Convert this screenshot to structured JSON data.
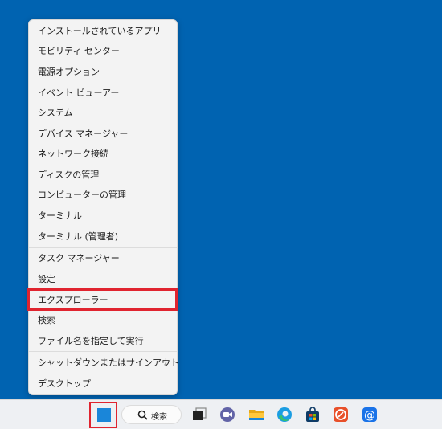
{
  "menu": {
    "items": [
      {
        "label": "インストールされているアプリ"
      },
      {
        "label": "モビリティ センター"
      },
      {
        "label": "電源オプション"
      },
      {
        "label": "イベント ビューアー"
      },
      {
        "label": "システム"
      },
      {
        "label": "デバイス マネージャー"
      },
      {
        "label": "ネットワーク接続"
      },
      {
        "label": "ディスクの管理"
      },
      {
        "label": "コンピューターの管理"
      },
      {
        "label": "ターミナル"
      },
      {
        "label": "ターミナル (管理者)"
      },
      {
        "label": "タスク マネージャー"
      },
      {
        "label": "設定"
      },
      {
        "label": "エクスプローラー"
      },
      {
        "label": "検索"
      },
      {
        "label": "ファイル名を指定して実行"
      },
      {
        "label": "シャットダウンまたはサインアウト",
        "chevron": "›"
      },
      {
        "label": "デスクトップ"
      }
    ]
  },
  "taskbar": {
    "search_label": "検索",
    "icons": [
      "windows-logo-icon",
      "search-icon",
      "task-view-icon",
      "teams-chat-icon",
      "file-explorer-icon",
      "edge-icon",
      "microsoft-store-icon",
      "app-icon",
      "mail-icon"
    ]
  },
  "colors": {
    "desktop": "#0063b1",
    "highlight_border": "#e0242f",
    "menu_bg": "#f3f3f3",
    "taskbar_bg": "#eef0f3"
  }
}
